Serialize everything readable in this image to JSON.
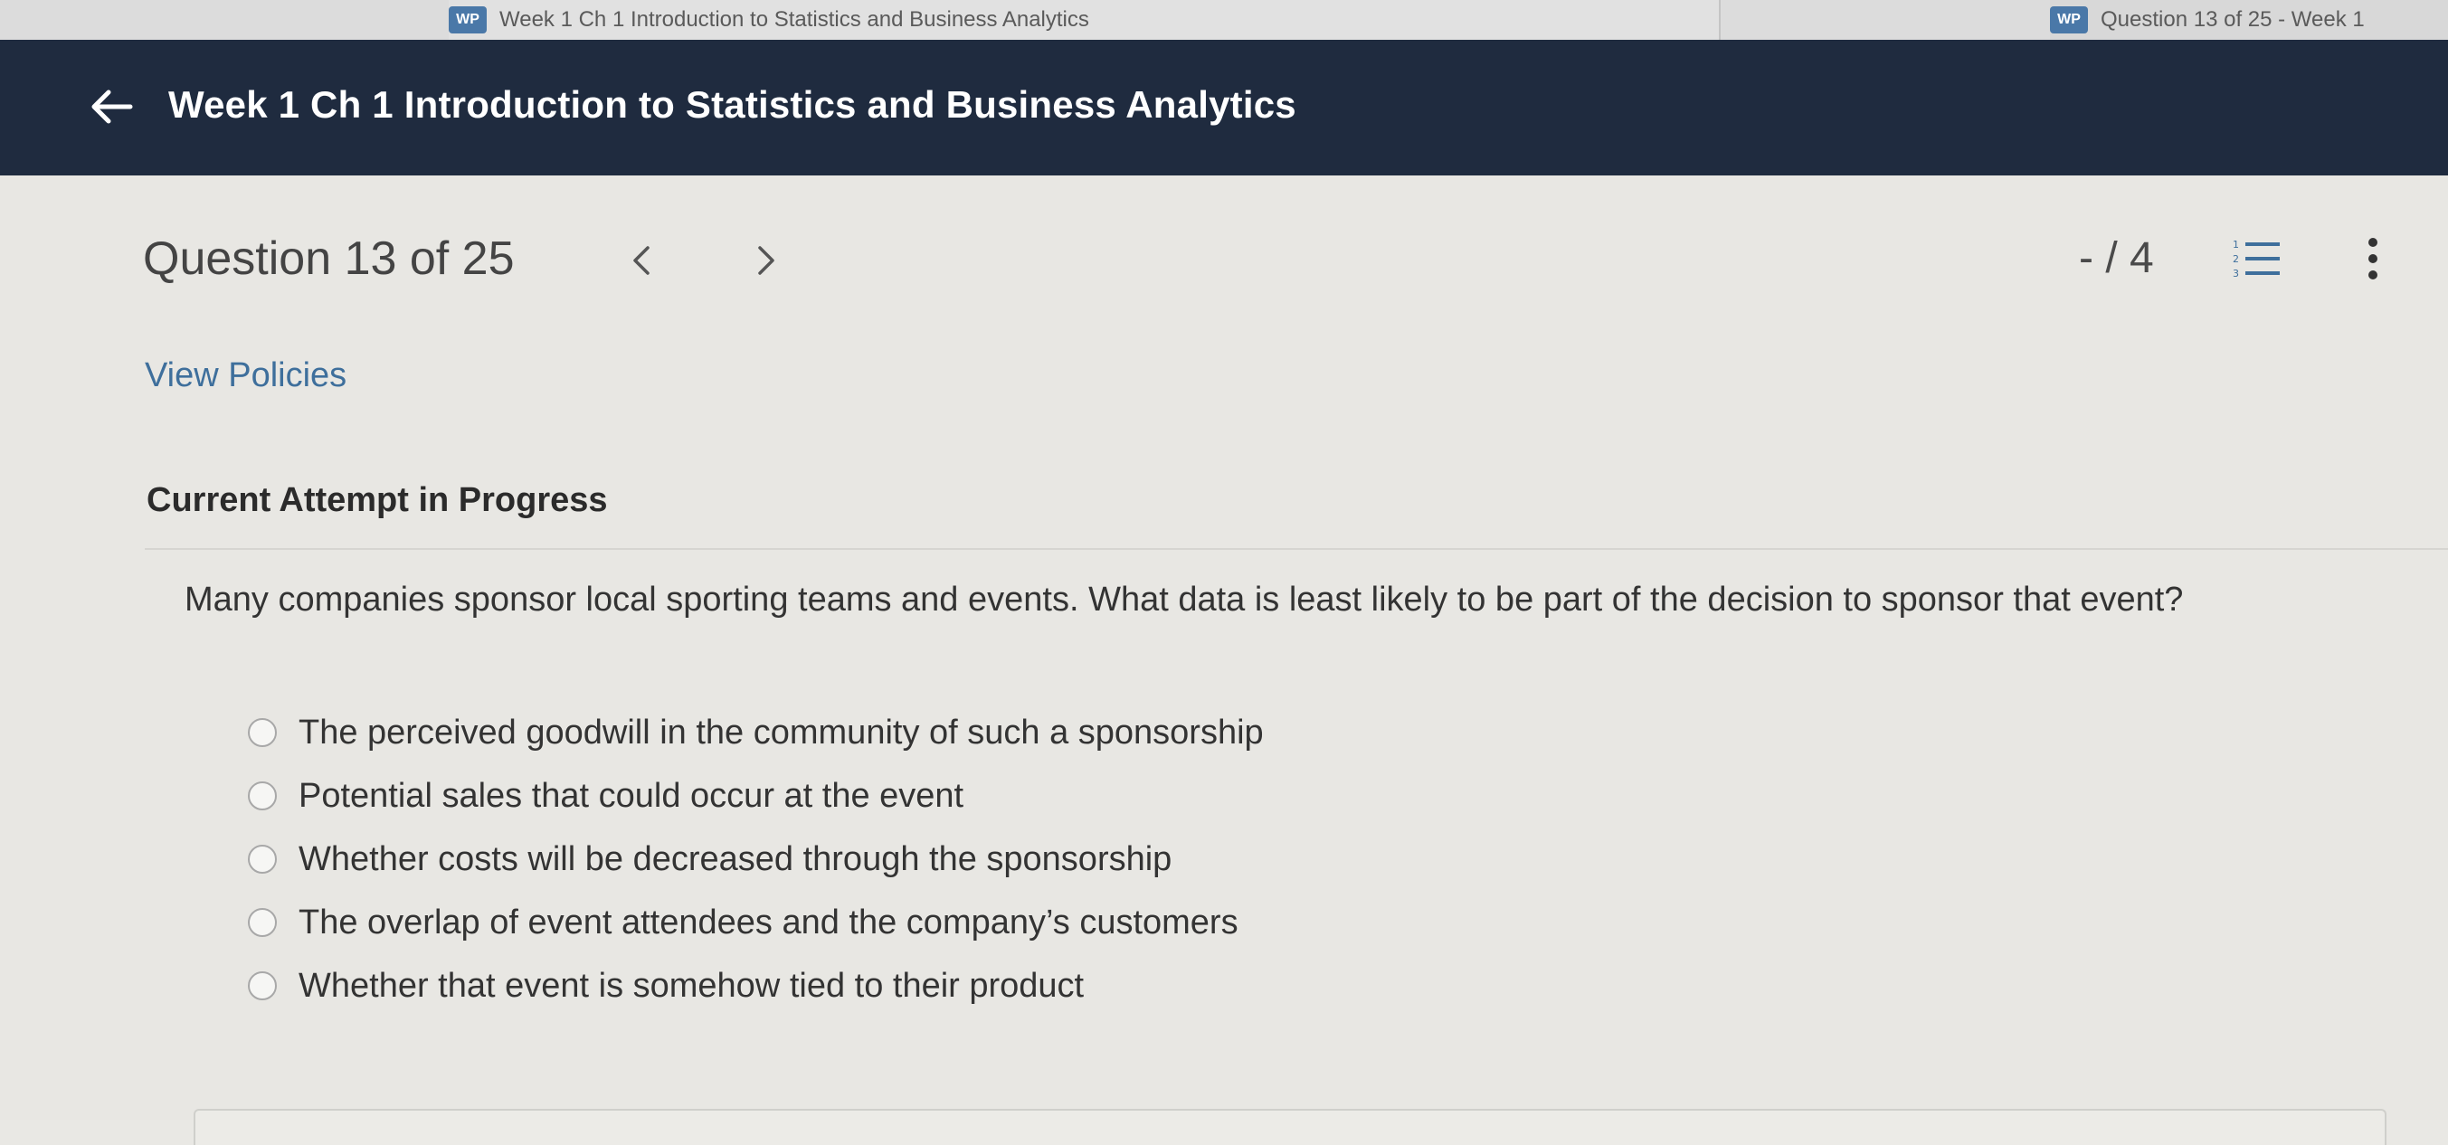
{
  "browser": {
    "tabs": [
      {
        "icon_text": "WP",
        "title": "Week 1 Ch 1 Introduction to Statistics and Business Analytics"
      },
      {
        "icon_text": "WP",
        "title": "Question 13 of 25 - Week 1"
      }
    ]
  },
  "header": {
    "back_icon": "left-arrow-icon",
    "title": "Week 1 Ch 1 Introduction to Statistics and Business Analytics",
    "background": "#1f2b3f"
  },
  "question_nav": {
    "counter": "Question 13 of 25",
    "prev_icon": "chevron-left-icon",
    "next_icon": "chevron-right-icon",
    "score": "- / 4",
    "list_icon": "numbered-list-icon",
    "more_icon": "vertical-ellipsis-icon"
  },
  "links": {
    "view_policies": "View Policies"
  },
  "attempt": {
    "label": "Current Attempt in Progress"
  },
  "question": {
    "text": "Many companies sponsor local sporting teams and events. What data is least likely to be part of the decision to sponsor that event?",
    "options": [
      "The perceived goodwill in the community of such a sponsorship",
      "Potential sales that could occur at the event",
      "Whether costs will be decreased through the sponsorship",
      "The overlap of event attendees and the company’s customers",
      "Whether that event is somehow tied to their product"
    ],
    "selected": null
  },
  "colors": {
    "link": "#3e6f9c",
    "page_background": "#e8e7e3"
  }
}
